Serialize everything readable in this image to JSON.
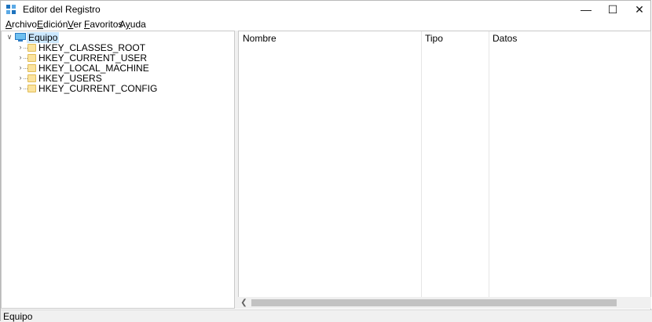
{
  "window": {
    "title": "Editor del Registro",
    "minimize_glyph": "—",
    "maximize_glyph": "☐",
    "close_glyph": "✕"
  },
  "menu": [
    {
      "accel": "A",
      "rest": "rchivo"
    },
    {
      "accel": "E",
      "rest": "dición"
    },
    {
      "accel": "V",
      "rest": "er"
    },
    {
      "accel": "F",
      "rest": "avoritos"
    },
    {
      "accel": "A",
      "rest": "yuda",
      "accel_pos": "second"
    }
  ],
  "tree": {
    "root": {
      "label": "Equipo",
      "icon": "computer-icon",
      "expanded": true
    },
    "children": [
      {
        "label": "HKEY_CLASSES_ROOT",
        "icon": "folder-icon"
      },
      {
        "label": "HKEY_CURRENT_USER",
        "icon": "folder-icon"
      },
      {
        "label": "HKEY_LOCAL_MACHINE",
        "icon": "folder-icon"
      },
      {
        "label": "HKEY_USERS",
        "icon": "folder-icon"
      },
      {
        "label": "HKEY_CURRENT_CONFIG",
        "icon": "folder-icon"
      }
    ]
  },
  "list": {
    "columns": [
      "Nombre",
      "Tipo",
      "Datos"
    ]
  },
  "status": {
    "text": "Equipo"
  },
  "colors": {
    "selection": "#cce8ff",
    "folder": "#fbe39d",
    "chrome": "#f0f0f0"
  }
}
